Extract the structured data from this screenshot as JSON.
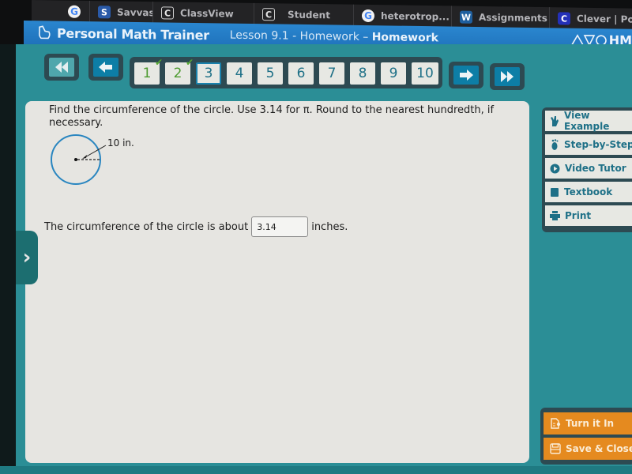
{
  "browser": {
    "tabs": [
      {
        "label": "",
        "icon": "google-icon"
      },
      {
        "label": "Savvas E",
        "icon": "savvas-icon"
      },
      {
        "label": "ClassView",
        "icon": "c-box-icon"
      },
      {
        "label": "Student",
        "icon": "c-box-icon"
      },
      {
        "label": "heterotrop...",
        "icon": "google-icon"
      },
      {
        "label": "Assignments",
        "icon": "w-icon"
      },
      {
        "label": "Clever | Por...",
        "icon": "clever-icon"
      }
    ]
  },
  "header": {
    "brand": "Personal Math Trainer",
    "lesson_prefix": "Lesson 9.1 - Homework –",
    "lesson_type": "Homework",
    "publisher": "HM"
  },
  "nav": {
    "questions": [
      {
        "label": "1",
        "status": "completed"
      },
      {
        "label": "2",
        "status": "completed"
      },
      {
        "label": "3",
        "status": "current"
      },
      {
        "label": "4",
        "status": "unanswered"
      },
      {
        "label": "5",
        "status": "unanswered"
      },
      {
        "label": "6",
        "status": "unanswered"
      },
      {
        "label": "7",
        "status": "unanswered"
      },
      {
        "label": "8",
        "status": "unanswered"
      },
      {
        "label": "9",
        "status": "unanswered"
      },
      {
        "label": "10",
        "status": "unanswered"
      }
    ],
    "check_mark": "✔"
  },
  "question": {
    "prompt": "Find the circumference of the circle. Use 3.14 for π. Round to the nearest hundredth, if necessary.",
    "radius_label": "10 in.",
    "answer_prefix": "The circumference of the circle is about",
    "answer_value": "3.14",
    "answer_suffix": "inches."
  },
  "tools": [
    {
      "label": "View Example",
      "icon": "hand-pointer-icon"
    },
    {
      "label": "Step-by-Step",
      "icon": "footprint-icon"
    },
    {
      "label": "Video Tutor",
      "icon": "play-icon"
    },
    {
      "label": "Textbook",
      "icon": "book-icon"
    },
    {
      "label": "Print",
      "icon": "printer-icon"
    }
  ],
  "actions": [
    {
      "label": "Turn it In",
      "icon": "turn-in-icon"
    },
    {
      "label": "Save & Close",
      "icon": "save-icon"
    }
  ],
  "colors": {
    "header_blue": "#1f72bb",
    "teal_bg": "#2b8e96",
    "action_orange": "#e58a1f",
    "tool_text": "#1e7087",
    "check_green": "#56a832"
  }
}
